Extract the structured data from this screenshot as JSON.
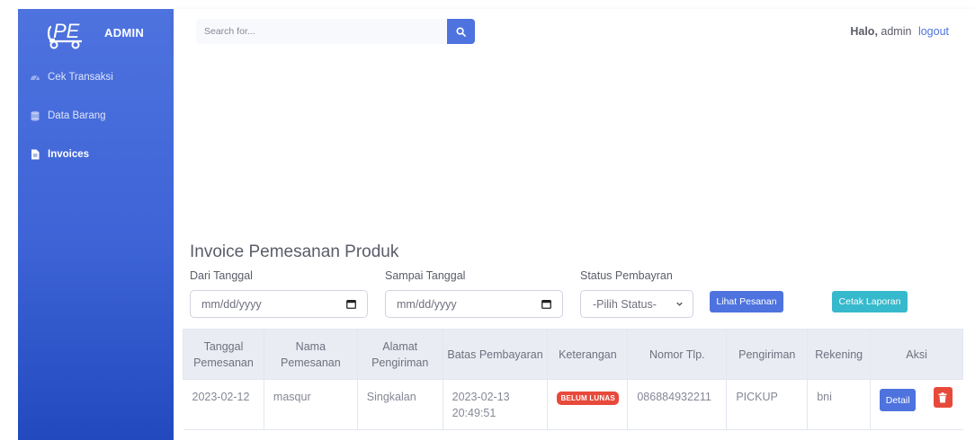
{
  "brand": {
    "text": "ADMIN"
  },
  "sidebar": {
    "items": [
      {
        "label": "Cek Transaksi",
        "icon": "gauge-icon"
      },
      {
        "label": "Data Barang",
        "icon": "database-icon"
      },
      {
        "label": "Invoices",
        "icon": "file-icon",
        "active": true
      }
    ]
  },
  "topbar": {
    "search_placeholder": "Search for...",
    "greeting_bold": "Halo,",
    "greeting_user": "admin",
    "logout_label": "logout"
  },
  "page": {
    "title": "Invoice Pemesanan Produk",
    "filters": {
      "dari_label": "Dari Tanggal",
      "sampai_label": "Sampai Tanggal",
      "status_label": "Status Pembayran",
      "date_placeholder": "mm/dd/yyyy",
      "status_selected": "-Pilih Status-"
    },
    "buttons": {
      "lihat": "Lihat Pesanan",
      "cetak": "Cetak Laporan"
    }
  },
  "table": {
    "headers": [
      "Tanggal Pemesanan",
      "Nama Pemesanan",
      "Alamat Pengiriman",
      "Batas Pembayaran",
      "Keterangan",
      "Nomor Tlp.",
      "Pengiriman",
      "Rekening",
      "Aksi"
    ],
    "rows": [
      {
        "tanggal": "2023-02-12",
        "nama": "masqur",
        "alamat": "Singkalan",
        "batas": "2023-02-13 20:49:51",
        "keterangan": "BELUM LUNAS",
        "nomor": "086884932211",
        "pengiriman": "PICKUP",
        "rekening": "bni",
        "detail_label": "Detail"
      }
    ]
  },
  "colors": {
    "primary": "#4e73df",
    "info": "#36b9cc",
    "danger": "#e74a3b"
  }
}
